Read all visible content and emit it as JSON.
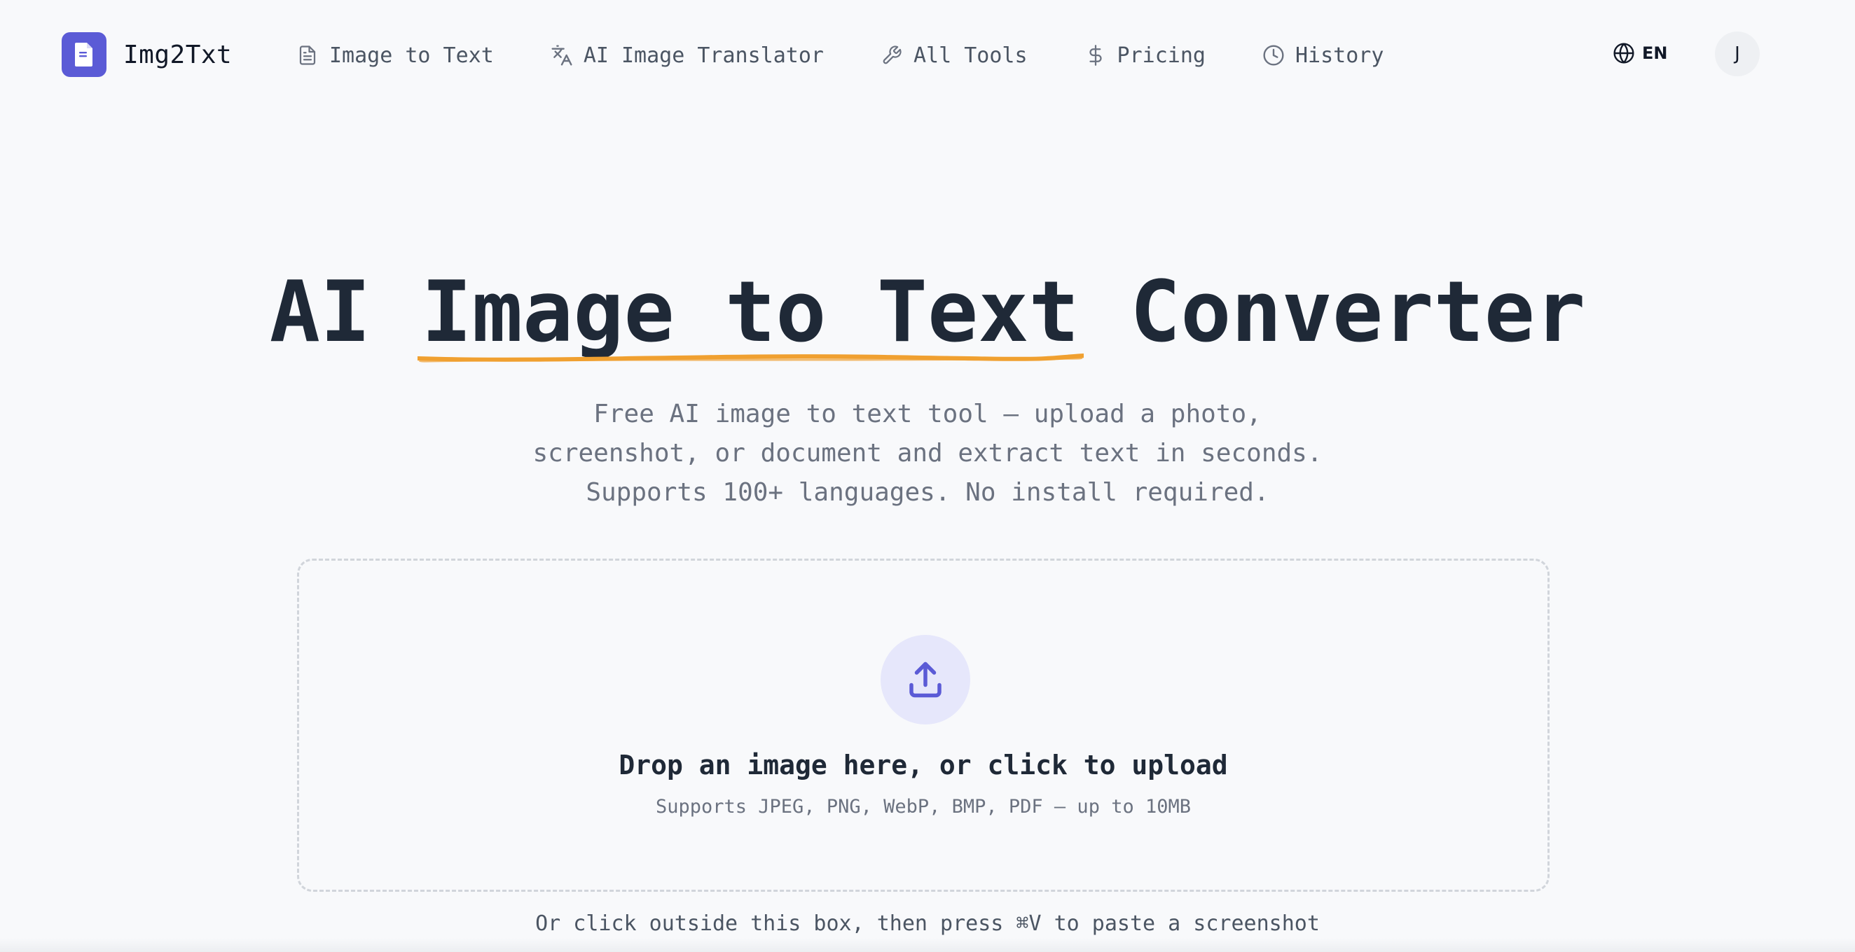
{
  "brand": {
    "name": "Img2Txt",
    "logo_icon": "document-icon",
    "accent": "#5b5bd6"
  },
  "nav": [
    {
      "label": "Image to Text",
      "icon": "document-icon"
    },
    {
      "label": "AI Image Translator",
      "icon": "translate-icon"
    },
    {
      "label": "All Tools",
      "icon": "wrench-icon"
    },
    {
      "label": "Pricing",
      "icon": "dollar-icon"
    },
    {
      "label": "History",
      "icon": "clock-icon"
    }
  ],
  "language": {
    "label": "EN",
    "icon": "globe-icon"
  },
  "user": {
    "initial": "J"
  },
  "hero": {
    "title_before": "AI ",
    "title_highlight": "Image to Text",
    "title_after": " Converter",
    "underline_color": "#f0a030",
    "subtitle_lines": [
      "Free AI image to text tool — upload a photo,",
      "screenshot, or document and extract text in seconds.",
      "Supports 100+ languages. No install required."
    ]
  },
  "upload": {
    "icon": "upload-icon",
    "title": "Drop an image here, or click to upload",
    "formats": "Supports JPEG, PNG, WebP, BMP, PDF — up to 10MB",
    "paste_hint": "Or click outside this box, then press ⌘V to paste a screenshot"
  }
}
